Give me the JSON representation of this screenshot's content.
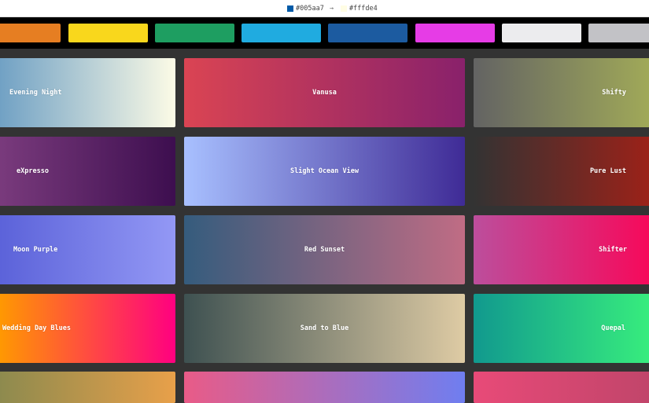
{
  "topbar": {
    "from": {
      "hex": "#005aa7",
      "swatch": "#005aa7"
    },
    "arrow": "→",
    "to": {
      "hex": "#fffde4",
      "swatch": "#fffde4"
    }
  },
  "palette": [
    {
      "name": "orange",
      "color": "#e67e22"
    },
    {
      "name": "yellow",
      "color": "#f9d71c"
    },
    {
      "name": "green",
      "color": "#1e9e61"
    },
    {
      "name": "light-blue",
      "color": "#20abe0"
    },
    {
      "name": "dark-blue",
      "color": "#1c5ba0"
    },
    {
      "name": "magenta",
      "color": "#e63ce6"
    },
    {
      "name": "white",
      "color": "#ececee"
    },
    {
      "name": "grey",
      "color": "#c2c2c6"
    }
  ],
  "gradients": [
    {
      "label": "Evening Night",
      "from": "#6fa0c4",
      "to": "#fcfbe6"
    },
    {
      "label": "Vanusa",
      "from": "#da4453",
      "to": "#89216b"
    },
    {
      "label": "Shifty",
      "from": "#636363",
      "to": "#a2ab58"
    },
    {
      "label": "eXpresso",
      "from": "#7a3b7d",
      "to": "#3d0e4f"
    },
    {
      "label": "Slight Ocean View",
      "from": "#a8c0ff",
      "to": "#3f2b96"
    },
    {
      "label": "Pure Lust",
      "from": "#333333",
      "to": "#9e2118"
    },
    {
      "label": "Moon Purple",
      "from": "#5b62d9",
      "to": "#9398f5"
    },
    {
      "label": "Red Sunset",
      "from": "#355c7d",
      "to": "#c06c84"
    },
    {
      "label": "Shifter",
      "from": "#bc4e9c",
      "to": "#f80759"
    },
    {
      "label": "Wedding Day Blues",
      "from": "#ff9a00",
      "to": "#ff0080"
    },
    {
      "label": "Sand to Blue",
      "from": "#3e5151",
      "to": "#decba4"
    },
    {
      "label": "Quepal",
      "from": "#11998e",
      "to": "#38ef7d"
    },
    {
      "label": "",
      "from": "#8c8a4e",
      "to": "#e8a04a"
    },
    {
      "label": "",
      "from": "#e95b87",
      "to": "#6f7ef0"
    },
    {
      "label": "",
      "from": "#e84a78",
      "to": "#c0456a"
    }
  ]
}
